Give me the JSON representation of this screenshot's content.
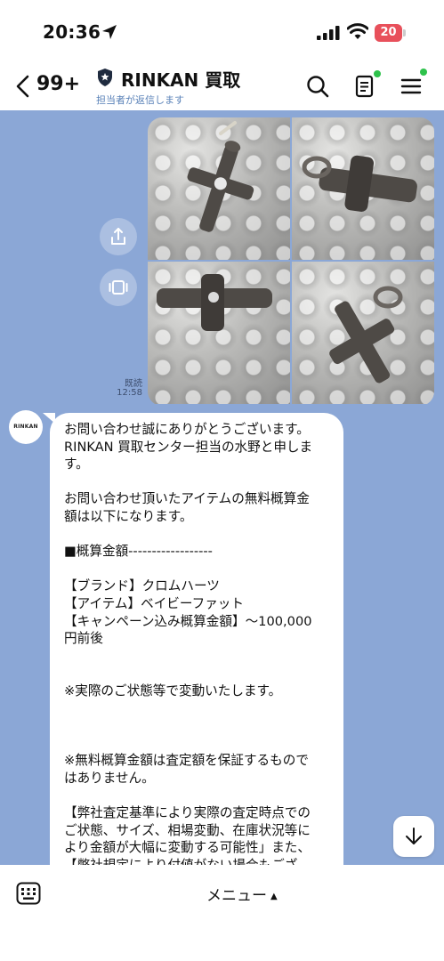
{
  "status_bar": {
    "time": "20:36",
    "battery_level": "20",
    "battery_color": "#e8505b"
  },
  "header": {
    "back_count": "99+",
    "title": "RINKAN 買取",
    "subtitle": "担当者が返信します",
    "icons": [
      "chevron-left-icon",
      "shield-icon",
      "search-icon",
      "notes-icon",
      "menu-icon"
    ],
    "badge_color": "#2ec24b"
  },
  "chat": {
    "background_color": "#8ba7d6",
    "photo_message": {
      "photo_count": 4,
      "read_label": "既読",
      "read_time": "12:58"
    },
    "reply": {
      "avatar_text": "RINKAN",
      "lines": [
        "お問い合わせ誠にありがとうございます。",
        "RINKAN 買取センター担当の水野と申しま",
        "す。",
        "",
        "お問い合わせ頂いたアイテムの無料概算金",
        "額は以下になります。",
        "",
        "■概算金額------------------",
        "",
        "【ブランド】クロムハーツ",
        "【アイテム】ベイビーファット",
        "【キャンペーン込み概算金額】～100,000",
        "円前後",
        "",
        "",
        "※実際のご状態等で変動いたします。",
        "",
        "",
        "",
        "※無料概算金額は査定額を保証するもので",
        "はありません。",
        "",
        "【弊社査定基準により実際の査定時点での",
        "ご状態、サイズ、相場変動、在庫状況等に",
        "より金額が大幅に変動する可能性」また、",
        "【弊社規定により付値がない場合もござ"
      ]
    }
  },
  "bottom_bar": {
    "menu_label": "メニュー",
    "menu_caret": "▲"
  }
}
